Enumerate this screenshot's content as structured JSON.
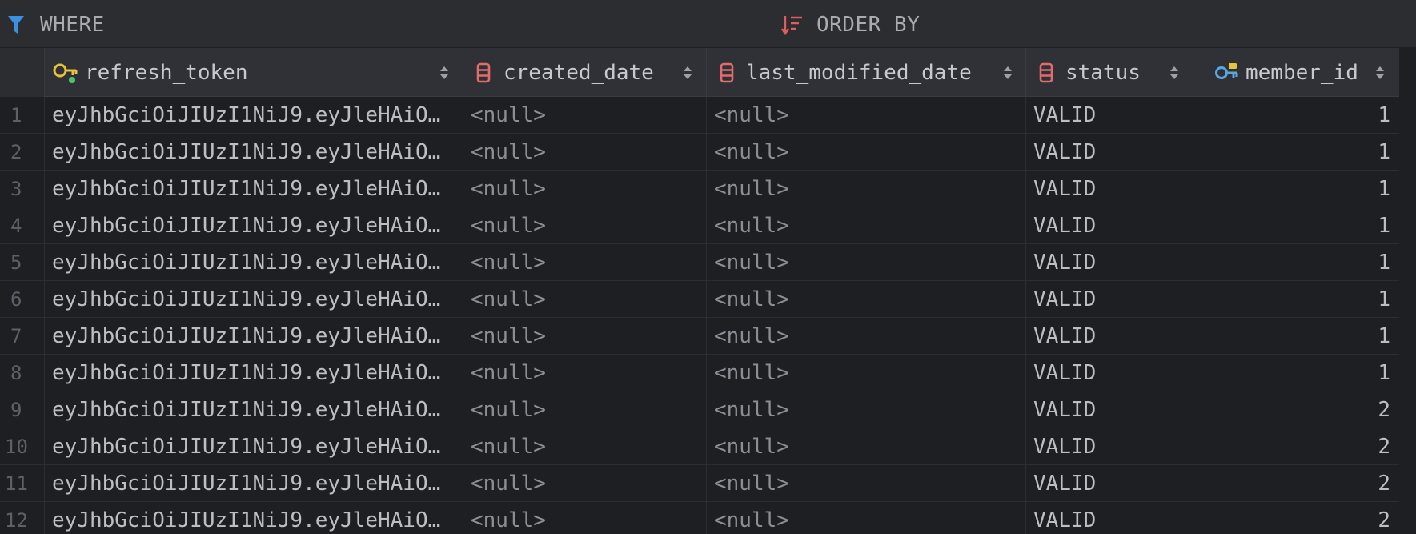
{
  "filter_bar": {
    "where_label": "WHERE",
    "order_by_label": "ORDER BY"
  },
  "columns": [
    {
      "name": "refresh_token",
      "icon": "key-column-icon"
    },
    {
      "name": "created_date",
      "icon": "column-icon"
    },
    {
      "name": "last_modified_date",
      "icon": "column-icon"
    },
    {
      "name": "status",
      "icon": "column-icon"
    },
    {
      "name": "member_id",
      "icon": "foreign-key-icon"
    }
  ],
  "rows": [
    {
      "num": "1",
      "refresh_token": "eyJhbGciOiJIUzI1NiJ9.eyJleHAiO…",
      "created_date": "<null>",
      "last_modified_date": "<null>",
      "status": "VALID",
      "member_id": "1"
    },
    {
      "num": "2",
      "refresh_token": "eyJhbGciOiJIUzI1NiJ9.eyJleHAiO…",
      "created_date": "<null>",
      "last_modified_date": "<null>",
      "status": "VALID",
      "member_id": "1"
    },
    {
      "num": "3",
      "refresh_token": "eyJhbGciOiJIUzI1NiJ9.eyJleHAiO…",
      "created_date": "<null>",
      "last_modified_date": "<null>",
      "status": "VALID",
      "member_id": "1"
    },
    {
      "num": "4",
      "refresh_token": "eyJhbGciOiJIUzI1NiJ9.eyJleHAiO…",
      "created_date": "<null>",
      "last_modified_date": "<null>",
      "status": "VALID",
      "member_id": "1"
    },
    {
      "num": "5",
      "refresh_token": "eyJhbGciOiJIUzI1NiJ9.eyJleHAiO…",
      "created_date": "<null>",
      "last_modified_date": "<null>",
      "status": "VALID",
      "member_id": "1"
    },
    {
      "num": "6",
      "refresh_token": "eyJhbGciOiJIUzI1NiJ9.eyJleHAiO…",
      "created_date": "<null>",
      "last_modified_date": "<null>",
      "status": "VALID",
      "member_id": "1"
    },
    {
      "num": "7",
      "refresh_token": "eyJhbGciOiJIUzI1NiJ9.eyJleHAiO…",
      "created_date": "<null>",
      "last_modified_date": "<null>",
      "status": "VALID",
      "member_id": "1"
    },
    {
      "num": "8",
      "refresh_token": "eyJhbGciOiJIUzI1NiJ9.eyJleHAiO…",
      "created_date": "<null>",
      "last_modified_date": "<null>",
      "status": "VALID",
      "member_id": "1"
    },
    {
      "num": "9",
      "refresh_token": "eyJhbGciOiJIUzI1NiJ9.eyJleHAiO…",
      "created_date": "<null>",
      "last_modified_date": "<null>",
      "status": "VALID",
      "member_id": "2"
    },
    {
      "num": "10",
      "refresh_token": "eyJhbGciOiJIUzI1NiJ9.eyJleHAiO…",
      "created_date": "<null>",
      "last_modified_date": "<null>",
      "status": "VALID",
      "member_id": "2"
    },
    {
      "num": "11",
      "refresh_token": "eyJhbGciOiJIUzI1NiJ9.eyJleHAiO…",
      "created_date": "<null>",
      "last_modified_date": "<null>",
      "status": "VALID",
      "member_id": "2"
    },
    {
      "num": "12",
      "refresh_token": "eyJhbGciOiJIUzI1NiJ9.eyJleHAiO…",
      "created_date": "<null>",
      "last_modified_date": "<null>",
      "status": "VALID",
      "member_id": "2"
    }
  ],
  "colors": {
    "background": "#1e1f22",
    "toolbar": "#2b2d30",
    "header": "#2f3136",
    "filter_icon": "#3d8fe0",
    "order_icon": "#e05d5d",
    "column_icon": "#e06c6c",
    "key_icon": "#e8c23a",
    "fk_icon": "#5aa7e0",
    "null_text": "#8b8e94"
  }
}
